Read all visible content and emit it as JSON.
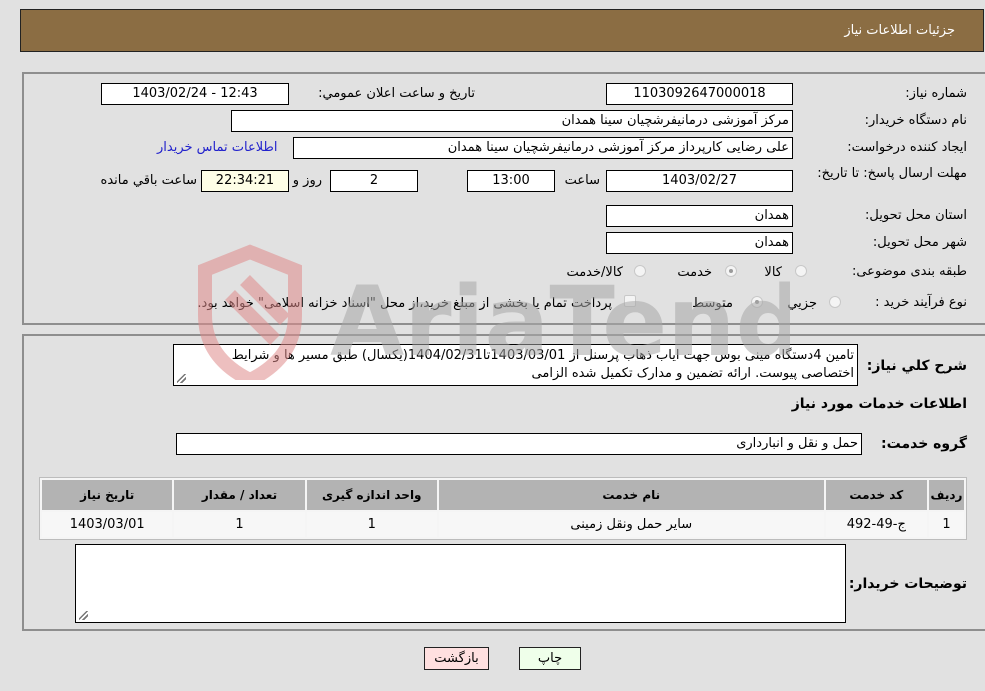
{
  "header": {
    "title": "جزئیات اطلاعات نیاز"
  },
  "details": {
    "need_number_label": "شماره نیاز:",
    "need_number": "1103092647000018",
    "announce_label": "تاريخ و ساعت اعلان عمومي:",
    "announce_value": "1403/02/24 - 12:43",
    "buyer_org_label": "نام دستگاه خریدار:",
    "buyer_org": "مرکز آموزشی درمانیفرشچیان سینا همدان",
    "creator_label": "ایجاد کننده درخواست:",
    "creator": "علی رضایی کارپرداز مرکز آموزشی درمانیفرشچیان سینا همدان",
    "contact_link": "اطلاعات تماس خریدار",
    "deadline_label": "مهلت ارسال پاسخ: تا تاریخ:",
    "deadline_date": "1403/02/27",
    "time_label": "ساعت",
    "deadline_time": "13:00",
    "days_value": "2",
    "days_label": "روز و",
    "remaining_time": "22:34:21",
    "remaining_label": "ساعت باقي مانده",
    "province_label": "استان محل تحویل:",
    "province": "همدان",
    "city_label": "شهر محل تحویل:",
    "city": "همدان",
    "category_label": "طبقه بندی موضوعی:",
    "category_options": [
      {
        "label": "کالا",
        "checked": false
      },
      {
        "label": "خدمت",
        "checked": true
      },
      {
        "label": "کالا/خدمت",
        "checked": false
      }
    ],
    "process_label": "نوع فرآیند خرید :",
    "process_options": [
      {
        "label": "جزيي",
        "checked": false
      },
      {
        "label": "متوسط",
        "checked": true
      }
    ],
    "payment_note": "پرداخت تمام یا بخشی از مبلغ خرید،از محل \"اسناد خزانه اسلامی\" خواهد بود."
  },
  "description": {
    "label": "شرح كلي نياز:",
    "text": "تامین 4دستگاه مینی بوس جهت ایاب ذهاب پرسنل از 1403/03/01تا1404/02/31(یکسال) طبق مسیر ها و شرایط اختصاصی پیوست. ارائه تضمین و مدارک تکمیل شده الزامی"
  },
  "services": {
    "section_title": "اطلاعات خدمات مورد نياز",
    "group_label": "گروه خدمت:",
    "group_value": "حمل و نقل و انبارداری",
    "columns": [
      "ردیف",
      "کد خدمت",
      "نام خدمت",
      "واحد اندازه گیری",
      "تعداد / مقدار",
      "تاریخ نیاز"
    ],
    "rows": [
      [
        "1",
        "ج-49-492",
        "سایر حمل ونقل زمینی",
        "1",
        "1",
        "1403/03/01"
      ]
    ]
  },
  "buyer_notes": {
    "label": "توضیحات خریدار:",
    "value": ""
  },
  "buttons": {
    "print": "چاپ",
    "back": "بازگشت"
  },
  "watermark": {
    "text": "AriaTender.neT"
  },
  "colors": {
    "header_bg": "#8b6d43",
    "print_bg": "#efffea",
    "back_bg": "#ffe0e0",
    "link": "#2222cc"
  }
}
